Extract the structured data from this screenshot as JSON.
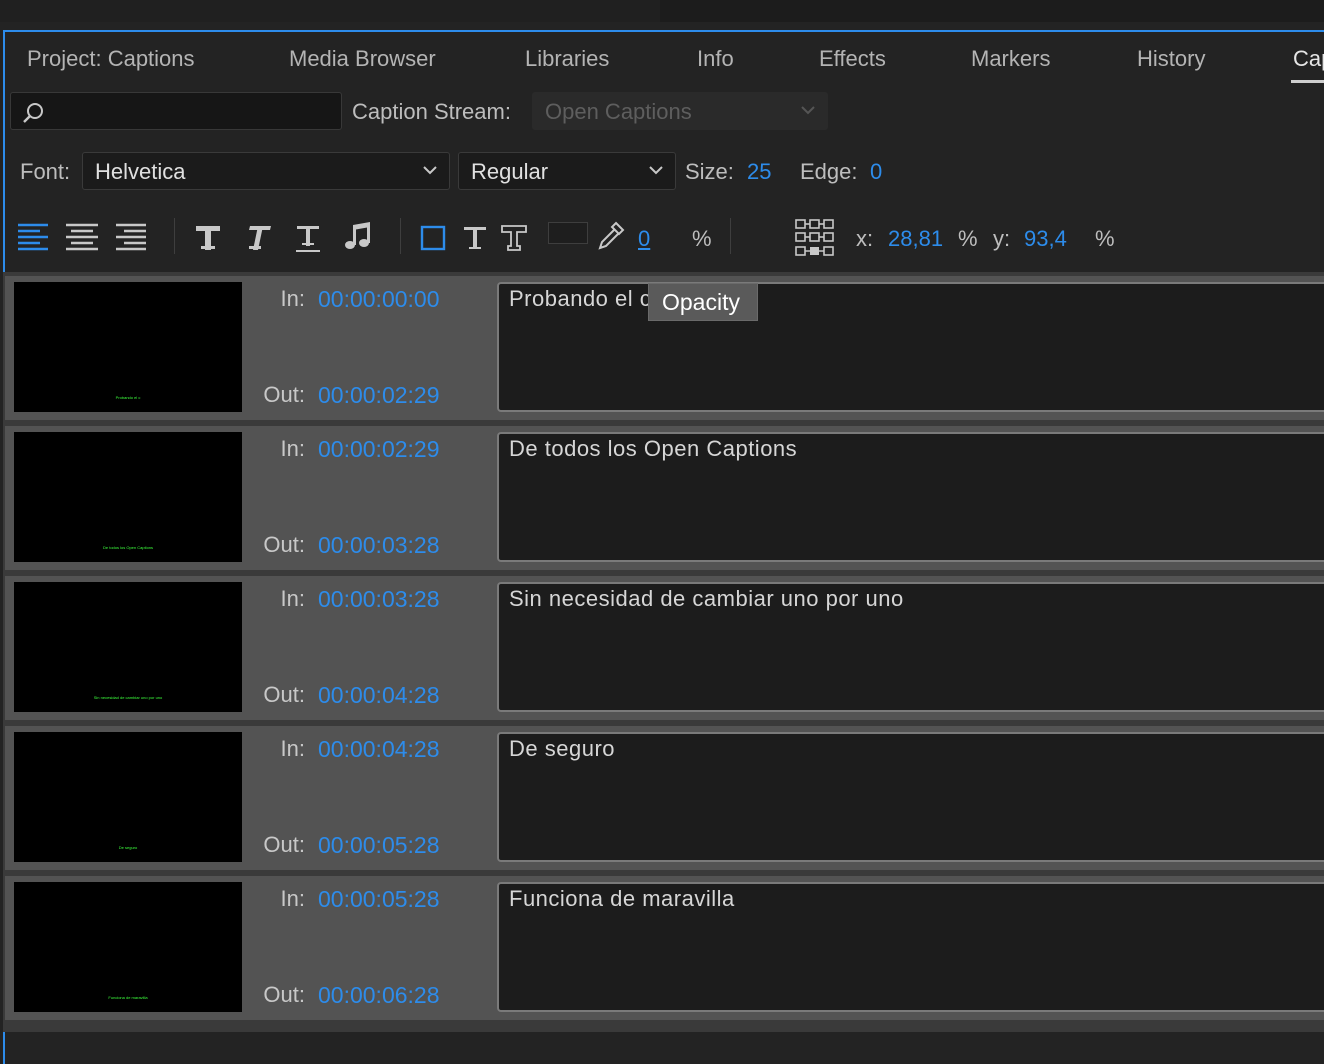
{
  "tabs": [
    {
      "label": "Project: Captions"
    },
    {
      "label": "Media Browser"
    },
    {
      "label": "Libraries"
    },
    {
      "label": "Info"
    },
    {
      "label": "Effects"
    },
    {
      "label": "Markers"
    },
    {
      "label": "History"
    },
    {
      "label": "Cap"
    }
  ],
  "search": {
    "placeholder": ""
  },
  "caption_stream": {
    "label": "Caption Stream:",
    "value": "Open Captions"
  },
  "font": {
    "label": "Font:",
    "family": "Helvetica",
    "style": "Regular",
    "size_label": "Size:",
    "size": "25",
    "edge_label": "Edge:",
    "edge": "0"
  },
  "format": {
    "opacity_value": "0",
    "opacity_unit": "%",
    "x_label": "x:",
    "x_value": "28,81",
    "x_unit": "%",
    "y_label": "y:",
    "y_value": "93,4",
    "y_unit": "%"
  },
  "tooltip": "Opacity",
  "labels": {
    "in": "In:",
    "out": "Out:"
  },
  "captions": [
    {
      "in": "00:00:00:00",
      "out": "00:00:02:29",
      "text": "Probando el c"
    },
    {
      "in": "00:00:02:29",
      "out": "00:00:03:28",
      "text": "De todos los Open Captions"
    },
    {
      "in": "00:00:03:28",
      "out": "00:00:04:28",
      "text": "Sin necesidad de cambiar uno por uno"
    },
    {
      "in": "00:00:04:28",
      "out": "00:00:05:28",
      "text": "De seguro"
    },
    {
      "in": "00:00:05:28",
      "out": "00:00:06:28",
      "text": "Funciona de maravilla"
    }
  ],
  "colors": {
    "accent": "#2d8ceb",
    "caption_preview": "#3cff3c"
  }
}
